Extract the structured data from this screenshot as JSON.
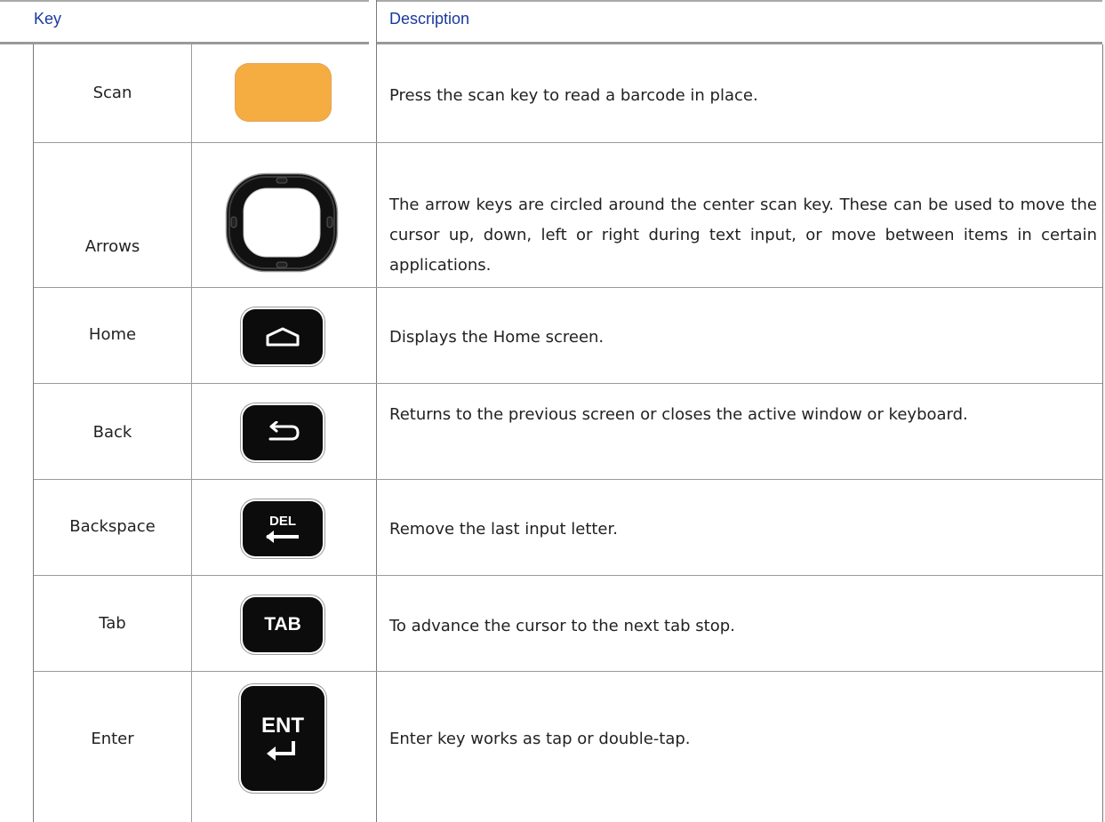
{
  "header": {
    "key": "Key",
    "description": "Description"
  },
  "rows": [
    {
      "name": "Scan",
      "icon": "orange-scan-key-icon",
      "description": "Press the scan key to read a barcode in place."
    },
    {
      "name": "Arrows",
      "icon": "arrow-ring-key-icon",
      "description": "The arrow keys are circled around the center scan key. These can be used to move the cursor up, down, left or right during text input, or move between items in certain applications."
    },
    {
      "name": "Home",
      "icon": "home-key-icon",
      "description": "Displays the Home screen."
    },
    {
      "name": "Back",
      "icon": "back-key-icon",
      "description": "Returns to the previous screen or closes the active window or keyboard."
    },
    {
      "name": "Backspace",
      "icon": "del-key-icon",
      "key_label": "DEL",
      "description": "Remove the last input letter."
    },
    {
      "name": "Tab",
      "icon": "tab-key-icon",
      "key_label": "TAB",
      "description": "To advance the cursor to the next tab stop."
    },
    {
      "name": "Enter",
      "icon": "ent-key-icon",
      "key_label": "ENT",
      "description": "Enter key works as tap or double-tap."
    }
  ],
  "colors": {
    "header_text": "#1a3a9c",
    "scan_key": "#f5ad42",
    "key_body": "#0c0c0c"
  }
}
